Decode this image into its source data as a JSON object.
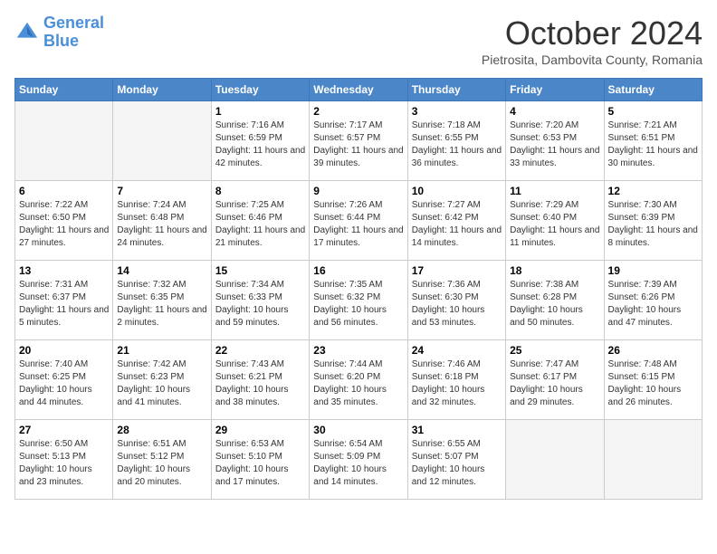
{
  "header": {
    "logo_line1": "General",
    "logo_line2": "Blue",
    "month": "October 2024",
    "location": "Pietrosita, Dambovita County, Romania"
  },
  "days_of_week": [
    "Sunday",
    "Monday",
    "Tuesday",
    "Wednesday",
    "Thursday",
    "Friday",
    "Saturday"
  ],
  "weeks": [
    [
      {
        "day": "",
        "info": ""
      },
      {
        "day": "",
        "info": ""
      },
      {
        "day": "1",
        "info": "Sunrise: 7:16 AM\nSunset: 6:59 PM\nDaylight: 11 hours and 42 minutes."
      },
      {
        "day": "2",
        "info": "Sunrise: 7:17 AM\nSunset: 6:57 PM\nDaylight: 11 hours and 39 minutes."
      },
      {
        "day": "3",
        "info": "Sunrise: 7:18 AM\nSunset: 6:55 PM\nDaylight: 11 hours and 36 minutes."
      },
      {
        "day": "4",
        "info": "Sunrise: 7:20 AM\nSunset: 6:53 PM\nDaylight: 11 hours and 33 minutes."
      },
      {
        "day": "5",
        "info": "Sunrise: 7:21 AM\nSunset: 6:51 PM\nDaylight: 11 hours and 30 minutes."
      }
    ],
    [
      {
        "day": "6",
        "info": "Sunrise: 7:22 AM\nSunset: 6:50 PM\nDaylight: 11 hours and 27 minutes."
      },
      {
        "day": "7",
        "info": "Sunrise: 7:24 AM\nSunset: 6:48 PM\nDaylight: 11 hours and 24 minutes."
      },
      {
        "day": "8",
        "info": "Sunrise: 7:25 AM\nSunset: 6:46 PM\nDaylight: 11 hours and 21 minutes."
      },
      {
        "day": "9",
        "info": "Sunrise: 7:26 AM\nSunset: 6:44 PM\nDaylight: 11 hours and 17 minutes."
      },
      {
        "day": "10",
        "info": "Sunrise: 7:27 AM\nSunset: 6:42 PM\nDaylight: 11 hours and 14 minutes."
      },
      {
        "day": "11",
        "info": "Sunrise: 7:29 AM\nSunset: 6:40 PM\nDaylight: 11 hours and 11 minutes."
      },
      {
        "day": "12",
        "info": "Sunrise: 7:30 AM\nSunset: 6:39 PM\nDaylight: 11 hours and 8 minutes."
      }
    ],
    [
      {
        "day": "13",
        "info": "Sunrise: 7:31 AM\nSunset: 6:37 PM\nDaylight: 11 hours and 5 minutes."
      },
      {
        "day": "14",
        "info": "Sunrise: 7:32 AM\nSunset: 6:35 PM\nDaylight: 11 hours and 2 minutes."
      },
      {
        "day": "15",
        "info": "Sunrise: 7:34 AM\nSunset: 6:33 PM\nDaylight: 10 hours and 59 minutes."
      },
      {
        "day": "16",
        "info": "Sunrise: 7:35 AM\nSunset: 6:32 PM\nDaylight: 10 hours and 56 minutes."
      },
      {
        "day": "17",
        "info": "Sunrise: 7:36 AM\nSunset: 6:30 PM\nDaylight: 10 hours and 53 minutes."
      },
      {
        "day": "18",
        "info": "Sunrise: 7:38 AM\nSunset: 6:28 PM\nDaylight: 10 hours and 50 minutes."
      },
      {
        "day": "19",
        "info": "Sunrise: 7:39 AM\nSunset: 6:26 PM\nDaylight: 10 hours and 47 minutes."
      }
    ],
    [
      {
        "day": "20",
        "info": "Sunrise: 7:40 AM\nSunset: 6:25 PM\nDaylight: 10 hours and 44 minutes."
      },
      {
        "day": "21",
        "info": "Sunrise: 7:42 AM\nSunset: 6:23 PM\nDaylight: 10 hours and 41 minutes."
      },
      {
        "day": "22",
        "info": "Sunrise: 7:43 AM\nSunset: 6:21 PM\nDaylight: 10 hours and 38 minutes."
      },
      {
        "day": "23",
        "info": "Sunrise: 7:44 AM\nSunset: 6:20 PM\nDaylight: 10 hours and 35 minutes."
      },
      {
        "day": "24",
        "info": "Sunrise: 7:46 AM\nSunset: 6:18 PM\nDaylight: 10 hours and 32 minutes."
      },
      {
        "day": "25",
        "info": "Sunrise: 7:47 AM\nSunset: 6:17 PM\nDaylight: 10 hours and 29 minutes."
      },
      {
        "day": "26",
        "info": "Sunrise: 7:48 AM\nSunset: 6:15 PM\nDaylight: 10 hours and 26 minutes."
      }
    ],
    [
      {
        "day": "27",
        "info": "Sunrise: 6:50 AM\nSunset: 5:13 PM\nDaylight: 10 hours and 23 minutes."
      },
      {
        "day": "28",
        "info": "Sunrise: 6:51 AM\nSunset: 5:12 PM\nDaylight: 10 hours and 20 minutes."
      },
      {
        "day": "29",
        "info": "Sunrise: 6:53 AM\nSunset: 5:10 PM\nDaylight: 10 hours and 17 minutes."
      },
      {
        "day": "30",
        "info": "Sunrise: 6:54 AM\nSunset: 5:09 PM\nDaylight: 10 hours and 14 minutes."
      },
      {
        "day": "31",
        "info": "Sunrise: 6:55 AM\nSunset: 5:07 PM\nDaylight: 10 hours and 12 minutes."
      },
      {
        "day": "",
        "info": ""
      },
      {
        "day": "",
        "info": ""
      }
    ]
  ]
}
